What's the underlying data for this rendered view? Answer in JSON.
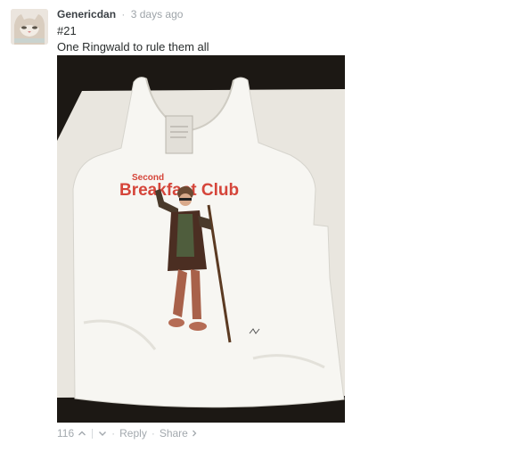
{
  "comment": {
    "username": "Genericdan",
    "separator": "·",
    "time": "3 days ago",
    "number": "#21",
    "text": "One Ringwald to rule them all",
    "image": {
      "shirt_text_small": "Second",
      "shirt_text_large": "Breakfast Club",
      "accent_color": "#d5453a"
    }
  },
  "footer": {
    "votes": "116",
    "upvote_icon": "chevron-up-icon",
    "downvote_icon": "chevron-down-icon",
    "reply": "Reply",
    "share": "Share",
    "share_icon": "chevron-right-icon"
  }
}
